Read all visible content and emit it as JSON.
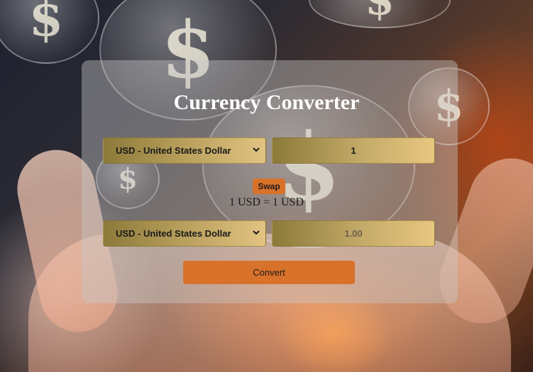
{
  "converter": {
    "title": "Currency Converter",
    "from_currency": "USD - United States Dollar",
    "from_amount": "1",
    "swap_label": "Swap",
    "rate_text": "1 USD = 1 USD",
    "to_currency": "USD - United States Dollar",
    "to_amount": "1.00",
    "convert_label": "Convert"
  },
  "background": {
    "bubble_symbol": "$"
  },
  "colors": {
    "accent": "#d8712a",
    "title": "#ffffff"
  },
  "icons": {
    "select_arrow": "chevron-down-icon"
  }
}
